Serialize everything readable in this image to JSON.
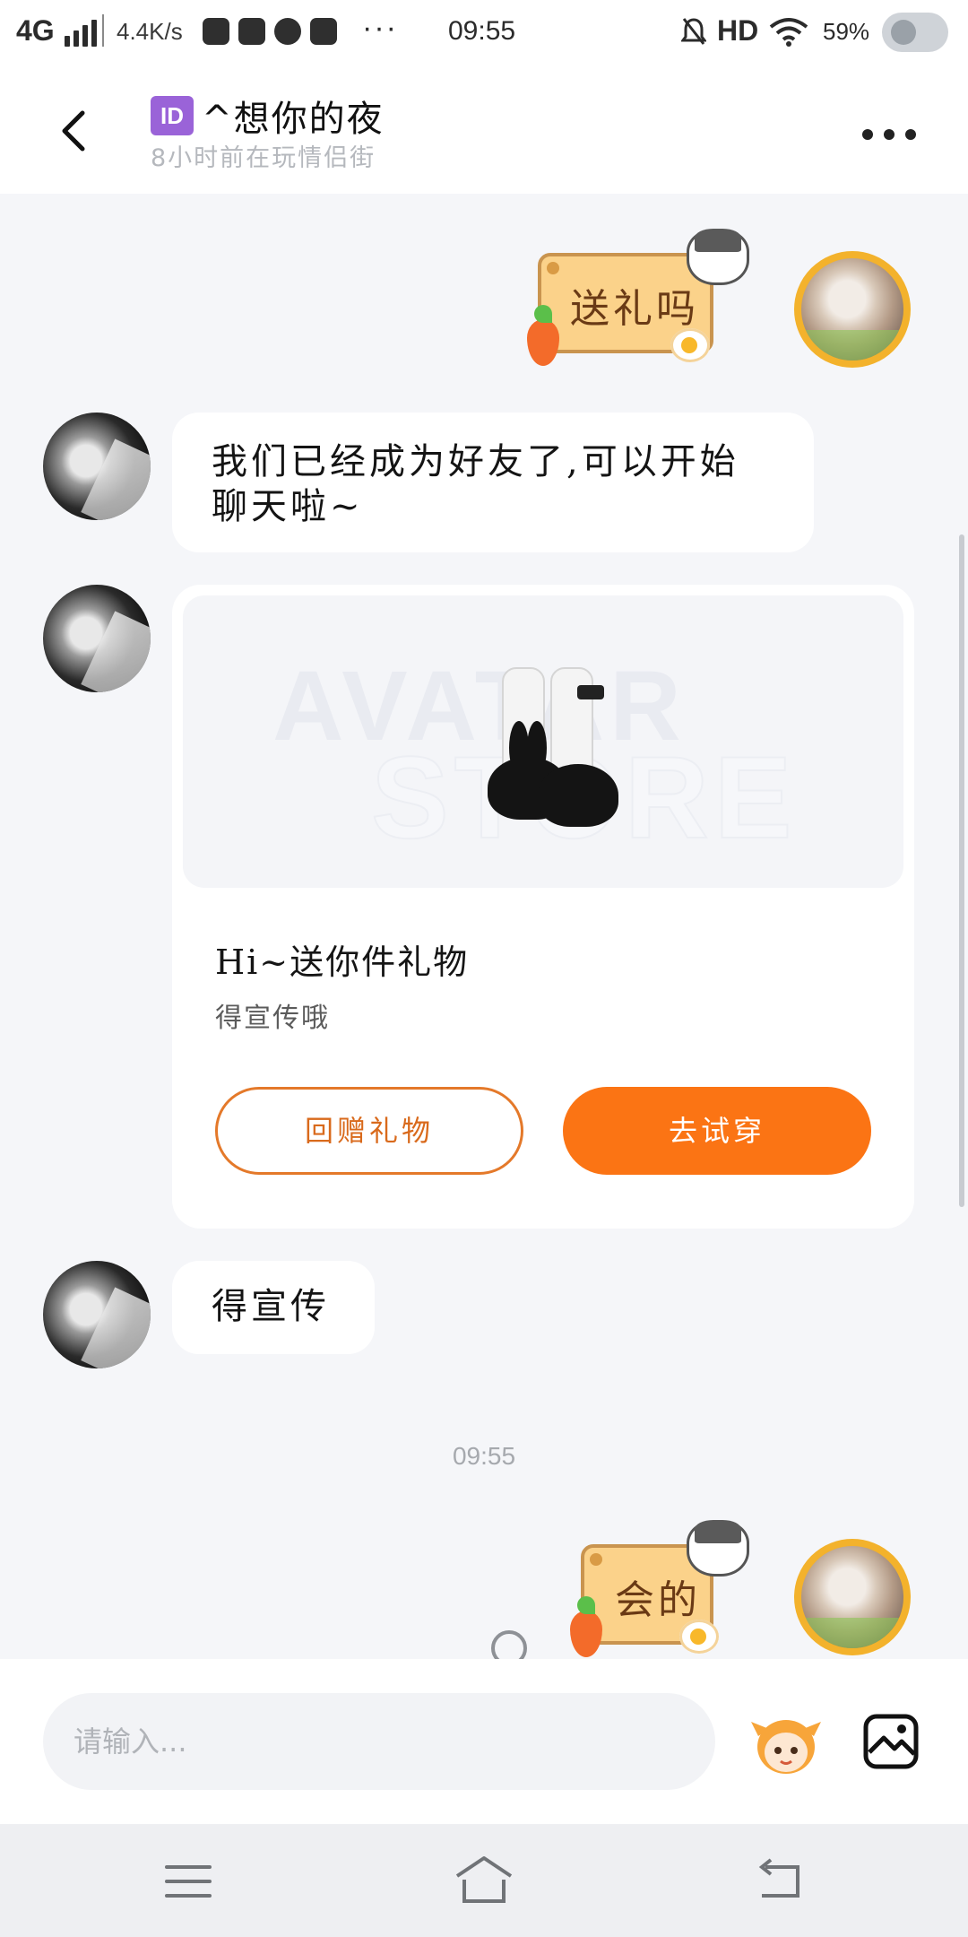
{
  "status_bar": {
    "network": "4G",
    "speed": "4.4K/s",
    "more": "···",
    "time": "09:55",
    "hd": "HD",
    "battery": "59%"
  },
  "header": {
    "id_badge": "ID",
    "title": "^想你的夜",
    "subtitle": "8小时前在玩情侣街"
  },
  "messages": {
    "sticker_1": "送礼吗",
    "text_1": "我们已经成为好友了,可以开始聊天啦~",
    "gift_card": {
      "watermark_top": "AVATAR",
      "watermark_bottom": "STORE",
      "title": "Hi~送你件礼物",
      "subtitle": "得宣传哦",
      "return_gift_label": "回赠礼物",
      "try_on_label": "去试穿"
    },
    "text_2": "得宣传",
    "timestamp": "09:55",
    "sticker_2": "会的"
  },
  "input": {
    "placeholder": "请输入..."
  },
  "icons": {
    "back": "chevron-left-icon",
    "more": "more-horizontal-icon",
    "emoji": "emoji-face-icon",
    "image": "image-icon",
    "nav_menu": "menu-icon",
    "nav_home": "home-icon",
    "nav_back": "back-arrow-icon"
  },
  "colors": {
    "accent": "#fb7414",
    "outline_button": "#e4792a",
    "id_badge": "#9a63d8",
    "background": "#f5f6f9"
  }
}
